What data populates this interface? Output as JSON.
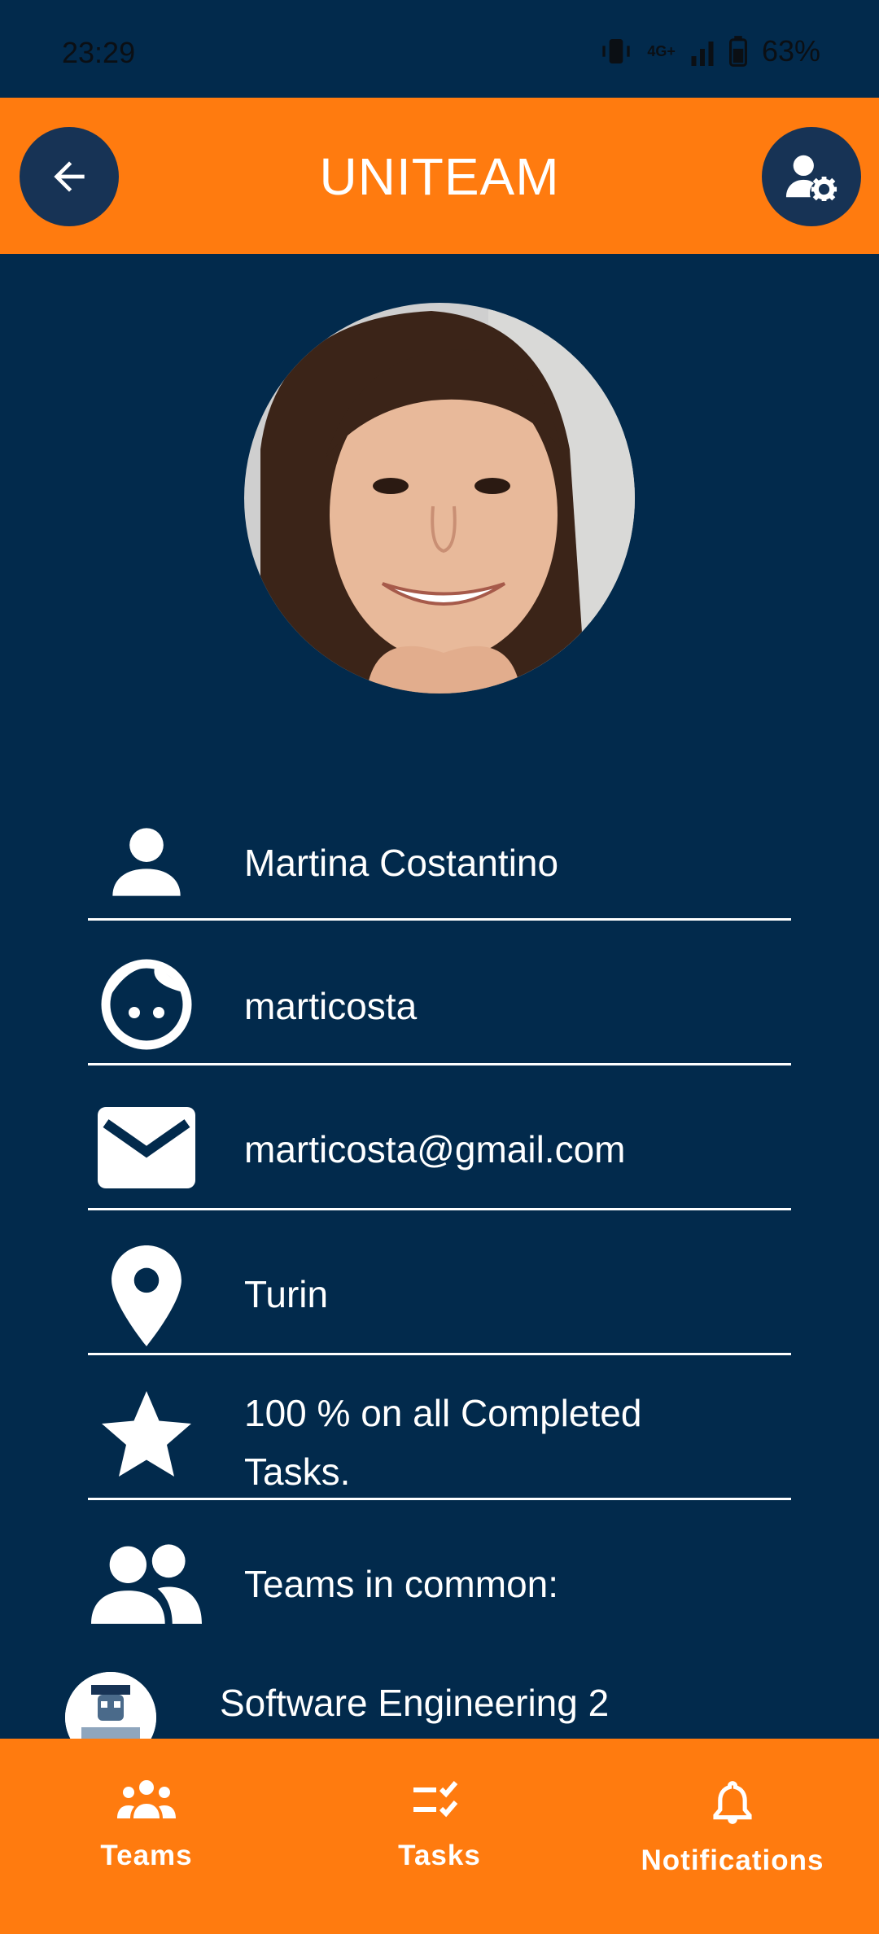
{
  "status_bar": {
    "time": "23:29",
    "battery": "63%",
    "network": "4G+"
  },
  "header": {
    "title": "UNITEAM"
  },
  "profile": {
    "name": "Martina Costantino",
    "username": "marticosta",
    "email": "marticosta@gmail.com",
    "location": "Turin",
    "completion_line1": "100 % on all Completed",
    "completion_line2": "Tasks.",
    "teams_heading": "Teams in common:"
  },
  "teams": [
    {
      "name": "Software Engineering 2"
    }
  ],
  "bottom_nav": [
    {
      "label": "Teams",
      "icon": "teams-icon"
    },
    {
      "label": "Tasks",
      "icon": "tasks-icon"
    },
    {
      "label": "Notifications",
      "icon": "bell-icon"
    }
  ],
  "colors": {
    "background": "#022a4c",
    "accent": "#ff7b0f",
    "button": "#173355"
  }
}
